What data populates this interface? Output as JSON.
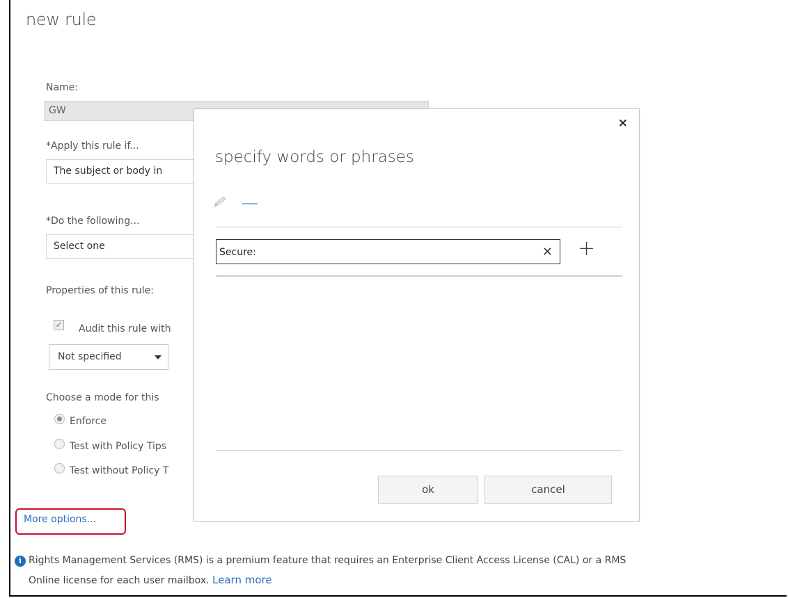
{
  "page": {
    "title": "new rule",
    "name_label": "Name:",
    "name_value": "GW",
    "apply_label": "*Apply this rule if...",
    "apply_value": "The subject or body in",
    "do_label": "*Do the following...",
    "do_value": "Select one",
    "properties_label": "Properties of this rule:",
    "audit_label": "Audit this rule with",
    "audit_checked": true,
    "severity_value": "Not specified",
    "mode_label": "Choose a mode for this",
    "modes": [
      "Enforce",
      "Test with Policy Tips",
      "Test without Policy T"
    ],
    "more_options": "More options...",
    "info_line1": "Rights Management Services (RMS) is a premium feature that requires an Enterprise Client Access License (CAL) or a RMS",
    "info_line2": "Online license for each user mailbox.",
    "learn_more": "Learn more"
  },
  "dialog": {
    "close_icon": "×",
    "title": "specify words or phrases",
    "word_value": "Secure:",
    "clear_icon": "×",
    "add_icon": "+",
    "ok_label": "ok",
    "cancel_label": "cancel"
  },
  "colors": {
    "link": "#2a6ebb",
    "highlight_border": "#c8102e",
    "info_icon": "#1e6fb8"
  }
}
